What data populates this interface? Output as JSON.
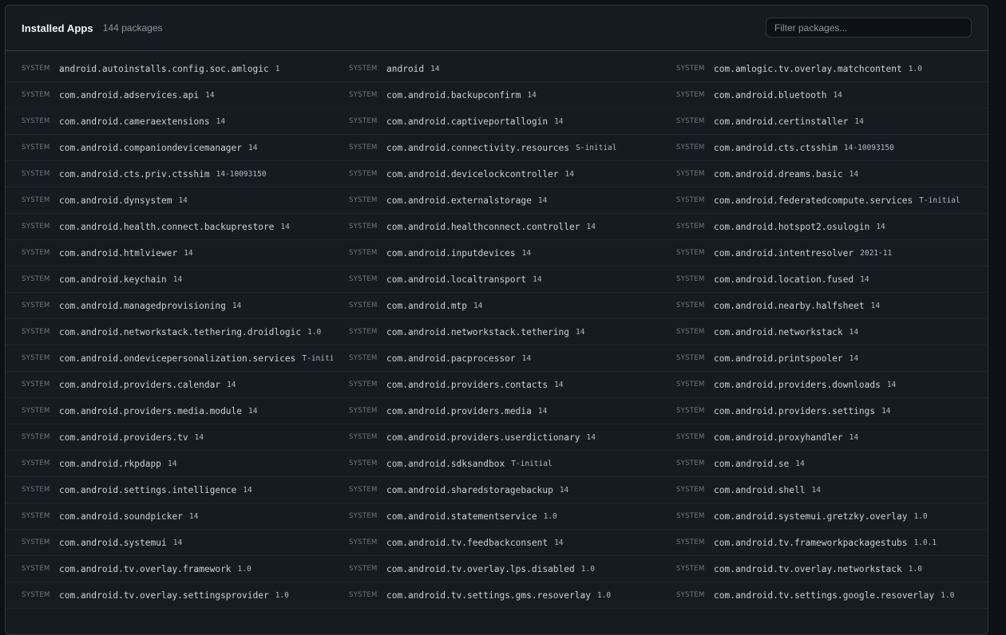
{
  "header": {
    "title": "Installed Apps",
    "count": "144 packages",
    "filter_placeholder": "Filter packages..."
  },
  "rows": [
    [
      {
        "tag": "SYSTEM",
        "name": "android.autoinstalls.config.soc.amlogic",
        "version": "1"
      },
      {
        "tag": "SYSTEM",
        "name": "android",
        "version": "14"
      },
      {
        "tag": "SYSTEM",
        "name": "com.amlogic.tv.overlay.matchcontent",
        "version": "1.0"
      }
    ],
    [
      {
        "tag": "SYSTEM",
        "name": "com.android.adservices.api",
        "version": "14"
      },
      {
        "tag": "SYSTEM",
        "name": "com.android.backupconfirm",
        "version": "14"
      },
      {
        "tag": "SYSTEM",
        "name": "com.android.bluetooth",
        "version": "14"
      }
    ],
    [
      {
        "tag": "SYSTEM",
        "name": "com.android.cameraextensions",
        "version": "14"
      },
      {
        "tag": "SYSTEM",
        "name": "com.android.captiveportallogin",
        "version": "14"
      },
      {
        "tag": "SYSTEM",
        "name": "com.android.certinstaller",
        "version": "14"
      }
    ],
    [
      {
        "tag": "SYSTEM",
        "name": "com.android.companiondevicemanager",
        "version": "14"
      },
      {
        "tag": "SYSTEM",
        "name": "com.android.connectivity.resources",
        "version": "S-initial"
      },
      {
        "tag": "SYSTEM",
        "name": "com.android.cts.ctsshim",
        "version": "14-10093150"
      }
    ],
    [
      {
        "tag": "SYSTEM",
        "name": "com.android.cts.priv.ctsshim",
        "version": "14-10093150"
      },
      {
        "tag": "SYSTEM",
        "name": "com.android.devicelockcontroller",
        "version": "14"
      },
      {
        "tag": "SYSTEM",
        "name": "com.android.dreams.basic",
        "version": "14"
      }
    ],
    [
      {
        "tag": "SYSTEM",
        "name": "com.android.dynsystem",
        "version": "14"
      },
      {
        "tag": "SYSTEM",
        "name": "com.android.externalstorage",
        "version": "14"
      },
      {
        "tag": "SYSTEM",
        "name": "com.android.federatedcompute.services",
        "version": "T-initial"
      }
    ],
    [
      {
        "tag": "SYSTEM",
        "name": "com.android.health.connect.backuprestore",
        "version": "14"
      },
      {
        "tag": "SYSTEM",
        "name": "com.android.healthconnect.controller",
        "version": "14"
      },
      {
        "tag": "SYSTEM",
        "name": "com.android.hotspot2.osulogin",
        "version": "14"
      }
    ],
    [
      {
        "tag": "SYSTEM",
        "name": "com.android.htmlviewer",
        "version": "14"
      },
      {
        "tag": "SYSTEM",
        "name": "com.android.inputdevices",
        "version": "14"
      },
      {
        "tag": "SYSTEM",
        "name": "com.android.intentresolver",
        "version": "2021-11"
      }
    ],
    [
      {
        "tag": "SYSTEM",
        "name": "com.android.keychain",
        "version": "14"
      },
      {
        "tag": "SYSTEM",
        "name": "com.android.localtransport",
        "version": "14"
      },
      {
        "tag": "SYSTEM",
        "name": "com.android.location.fused",
        "version": "14"
      }
    ],
    [
      {
        "tag": "SYSTEM",
        "name": "com.android.managedprovisioning",
        "version": "14"
      },
      {
        "tag": "SYSTEM",
        "name": "com.android.mtp",
        "version": "14"
      },
      {
        "tag": "SYSTEM",
        "name": "com.android.nearby.halfsheet",
        "version": "14"
      }
    ],
    [
      {
        "tag": "SYSTEM",
        "name": "com.android.networkstack.tethering.droidlogic",
        "version": "1.0"
      },
      {
        "tag": "SYSTEM",
        "name": "com.android.networkstack.tethering",
        "version": "14"
      },
      {
        "tag": "SYSTEM",
        "name": "com.android.networkstack",
        "version": "14"
      }
    ],
    [
      {
        "tag": "SYSTEM",
        "name": "com.android.ondevicepersonalization.services",
        "version": "T-initia"
      },
      {
        "tag": "SYSTEM",
        "name": "com.android.pacprocessor",
        "version": "14"
      },
      {
        "tag": "SYSTEM",
        "name": "com.android.printspooler",
        "version": "14"
      }
    ],
    [
      {
        "tag": "SYSTEM",
        "name": "com.android.providers.calendar",
        "version": "14"
      },
      {
        "tag": "SYSTEM",
        "name": "com.android.providers.contacts",
        "version": "14"
      },
      {
        "tag": "SYSTEM",
        "name": "com.android.providers.downloads",
        "version": "14"
      }
    ],
    [
      {
        "tag": "SYSTEM",
        "name": "com.android.providers.media.module",
        "version": "14"
      },
      {
        "tag": "SYSTEM",
        "name": "com.android.providers.media",
        "version": "14"
      },
      {
        "tag": "SYSTEM",
        "name": "com.android.providers.settings",
        "version": "14"
      }
    ],
    [
      {
        "tag": "SYSTEM",
        "name": "com.android.providers.tv",
        "version": "14"
      },
      {
        "tag": "SYSTEM",
        "name": "com.android.providers.userdictionary",
        "version": "14"
      },
      {
        "tag": "SYSTEM",
        "name": "com.android.proxyhandler",
        "version": "14"
      }
    ],
    [
      {
        "tag": "SYSTEM",
        "name": "com.android.rkpdapp",
        "version": "14"
      },
      {
        "tag": "SYSTEM",
        "name": "com.android.sdksandbox",
        "version": "T-initial"
      },
      {
        "tag": "SYSTEM",
        "name": "com.android.se",
        "version": "14"
      }
    ],
    [
      {
        "tag": "SYSTEM",
        "name": "com.android.settings.intelligence",
        "version": "14"
      },
      {
        "tag": "SYSTEM",
        "name": "com.android.sharedstoragebackup",
        "version": "14"
      },
      {
        "tag": "SYSTEM",
        "name": "com.android.shell",
        "version": "14"
      }
    ],
    [
      {
        "tag": "SYSTEM",
        "name": "com.android.soundpicker",
        "version": "14"
      },
      {
        "tag": "SYSTEM",
        "name": "com.android.statementservice",
        "version": "1.0"
      },
      {
        "tag": "SYSTEM",
        "name": "com.android.systemui.gretzky.overlay",
        "version": "1.0"
      }
    ],
    [
      {
        "tag": "SYSTEM",
        "name": "com.android.systemui",
        "version": "14"
      },
      {
        "tag": "SYSTEM",
        "name": "com.android.tv.feedbackconsent",
        "version": "14"
      },
      {
        "tag": "SYSTEM",
        "name": "com.android.tv.frameworkpackagestubs",
        "version": "1.0.1"
      }
    ],
    [
      {
        "tag": "SYSTEM",
        "name": "com.android.tv.overlay.framework",
        "version": "1.0"
      },
      {
        "tag": "SYSTEM",
        "name": "com.android.tv.overlay.lps.disabled",
        "version": "1.0"
      },
      {
        "tag": "SYSTEM",
        "name": "com.android.tv.overlay.networkstack",
        "version": "1.0"
      }
    ],
    [
      {
        "tag": "SYSTEM",
        "name": "com.android.tv.overlay.settingsprovider",
        "version": "1.0"
      },
      {
        "tag": "SYSTEM",
        "name": "com.android.tv.settings.gms.resoverlay",
        "version": "1.0"
      },
      {
        "tag": "SYSTEM",
        "name": "com.android.tv.settings.google.resoverlay",
        "version": "1.0"
      }
    ]
  ]
}
